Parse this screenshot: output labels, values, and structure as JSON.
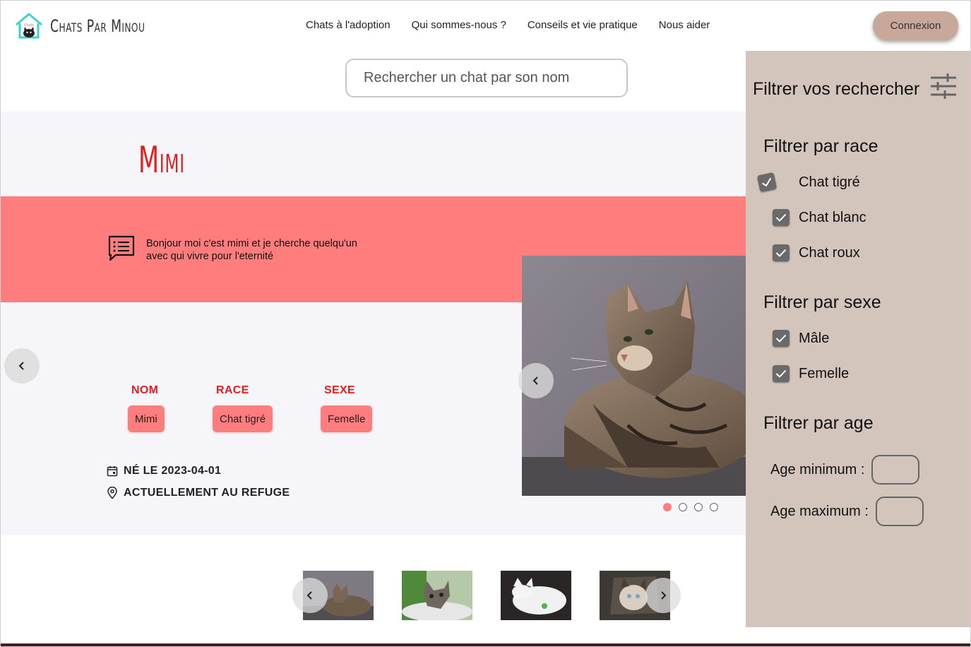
{
  "header": {
    "logo_text": "Chats Par Minou",
    "nav": [
      "Chats à l'adoption",
      "Qui sommes-nous ?",
      "Conseils et vie pratique",
      "Nous aider"
    ],
    "login_label": "Connexion"
  },
  "search": {
    "placeholder": "Rechercher un chat par son nom"
  },
  "cat": {
    "name": "Mimi",
    "message": "Bonjour moi c'est mimi et je cherche quelqu'un avec qui vivre pour l'eternité",
    "fields": [
      {
        "label": "NOM",
        "value": "Mimi"
      },
      {
        "label": "RACE",
        "value": "Chat tigré"
      },
      {
        "label": "SEXE",
        "value": "Femelle"
      }
    ],
    "birth": "NÉ LE 2023-04-01",
    "location": "ACTUELLEMENT AU REFUGE",
    "carousel": {
      "slides": 4,
      "active": 1
    }
  },
  "filters": {
    "title": "Filtrer vos rechercher",
    "race": {
      "title": "Filtrer par race",
      "options": [
        {
          "label": "Chat tigré",
          "checked": true
        },
        {
          "label": "Chat blanc",
          "checked": true
        },
        {
          "label": "Chat roux",
          "checked": true
        }
      ]
    },
    "sexe": {
      "title": "Filtrer par sexe",
      "options": [
        {
          "label": "Mâle",
          "checked": true
        },
        {
          "label": "Femelle",
          "checked": true
        }
      ]
    },
    "age": {
      "title": "Filtrer par age",
      "min_label": "Age minimum :",
      "max_label": "Age maximum :"
    }
  },
  "colors": {
    "accent": "#ff7d7d",
    "title_red": "#e0201e",
    "panel_bg": "#d4c5bc",
    "login_bg": "#c8a898"
  }
}
